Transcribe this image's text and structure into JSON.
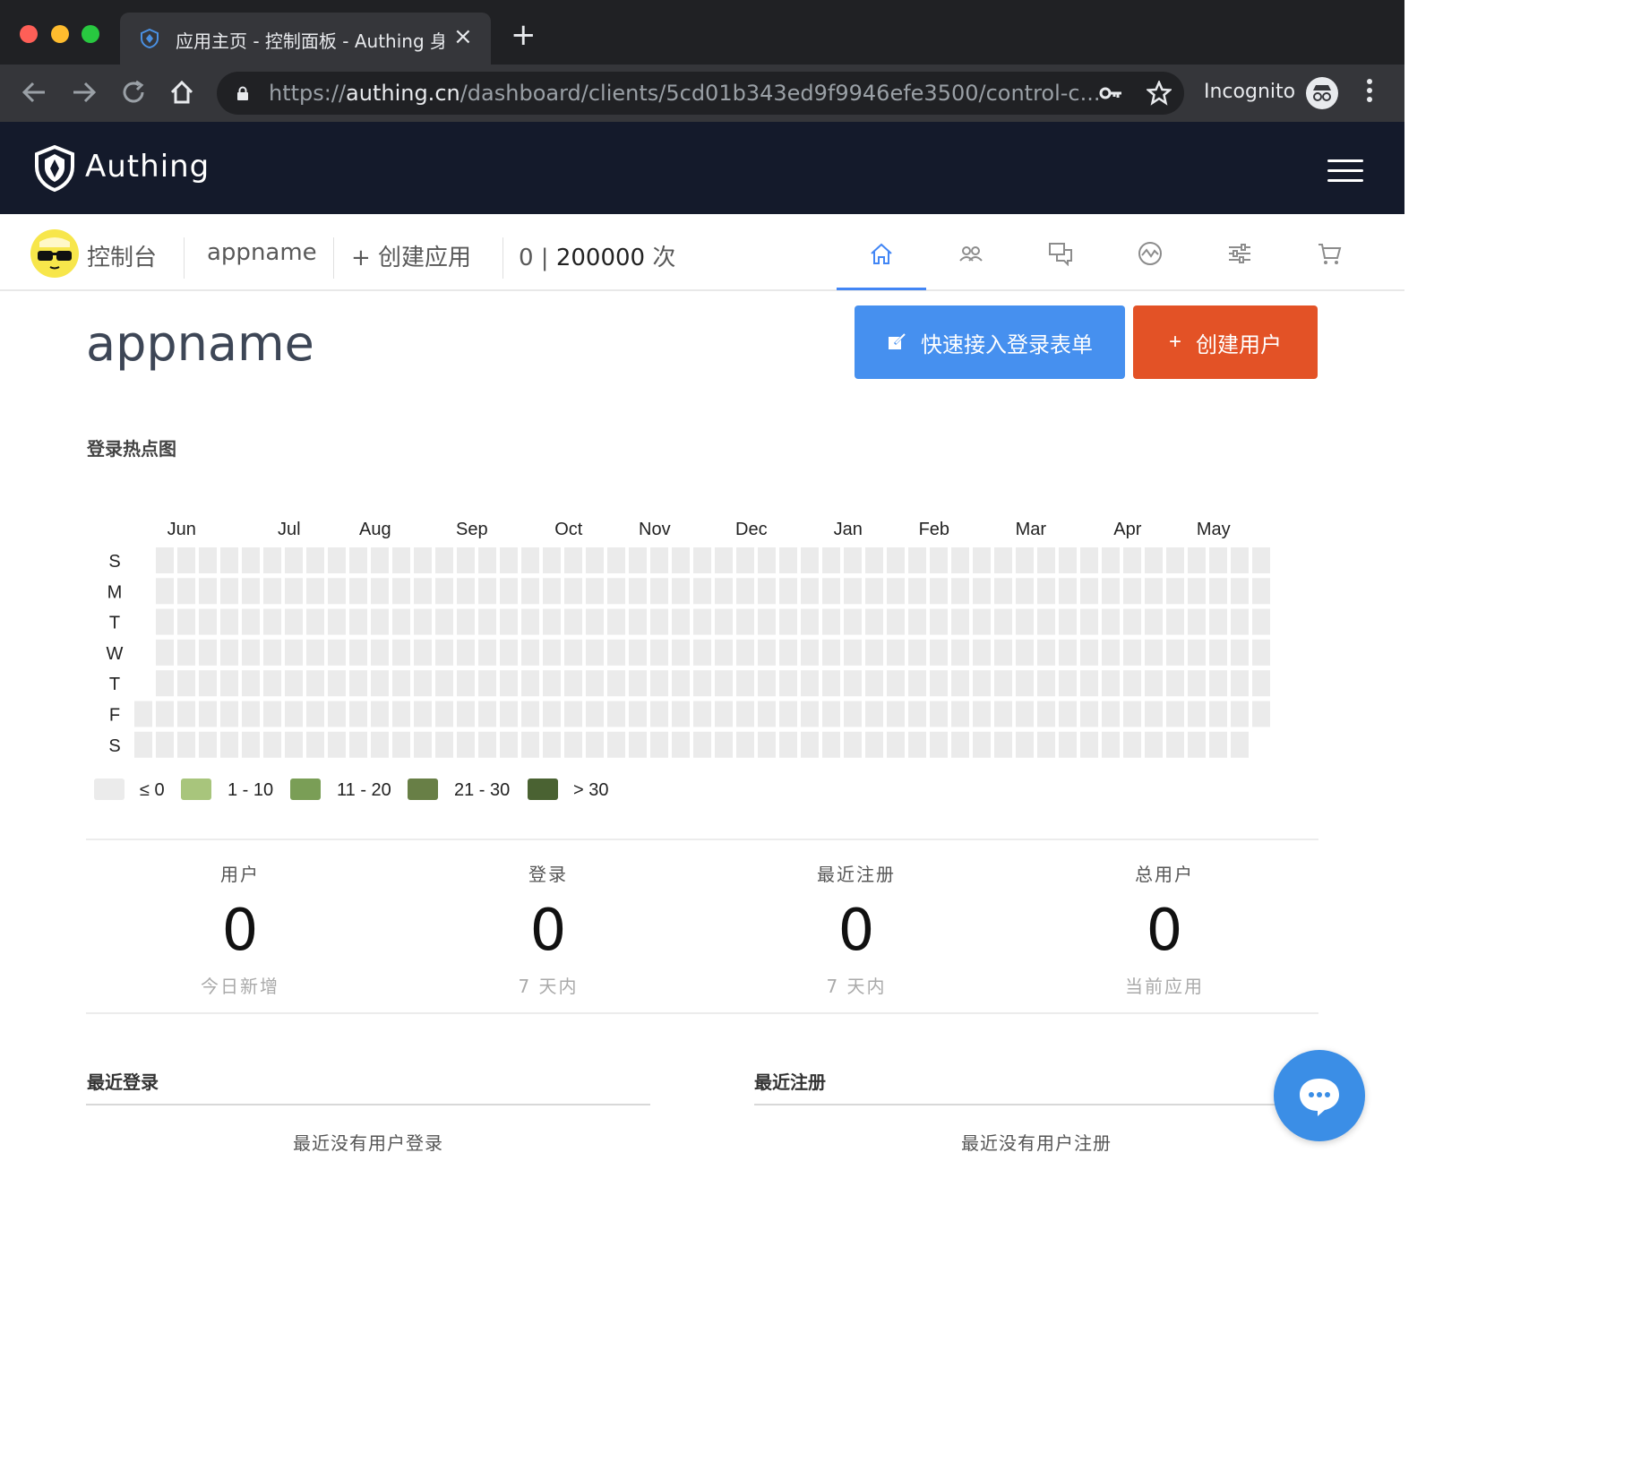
{
  "browser": {
    "tab_title": "应用主页 - 控制面板 - Authing 身",
    "url_prefix": "https://",
    "url_host": "authing.cn",
    "url_path": "/dashboard/clients/5cd01b343ed9f9946efe3500/control-c...",
    "incognito_label": "Incognito",
    "traffic_colors": [
      "#ff5f57",
      "#febc2e",
      "#28c840"
    ]
  },
  "app": {
    "brand": "Authing"
  },
  "subnav": {
    "console": "控制台",
    "app_name": "appname",
    "create_app": "+ 创建应用",
    "usage_used": "0",
    "usage_sep": " | ",
    "usage_total": "200000",
    "usage_unit": " 次",
    "tabs": [
      "home-icon",
      "users-icon",
      "messages-icon",
      "analytics-icon",
      "settings-icon",
      "cart-icon"
    ],
    "active_tab": 0,
    "accent": "#4286f5"
  },
  "main": {
    "title": "appname",
    "quick_login_button": "快速接入登录表单",
    "create_user_button": "创建用户",
    "heatmap_title": "登录热点图"
  },
  "chart_data": {
    "type": "heatmap",
    "title": "登录热点图",
    "months": [
      "Jun",
      "Jul",
      "Aug",
      "Sep",
      "Oct",
      "Nov",
      "Dec",
      "Jan",
      "Feb",
      "Mar",
      "Apr",
      "May"
    ],
    "weekdays": [
      "S",
      "M",
      "T",
      "W",
      "T",
      "F",
      "S"
    ],
    "values": "all 0",
    "legend": [
      {
        "label": "≤ 0",
        "color": "#ebebeb"
      },
      {
        "label": "1 - 10",
        "color": "#a8c57c"
      },
      {
        "label": "11 - 20",
        "color": "#7a9e56"
      },
      {
        "label": "21 - 30",
        "color": "#687f46"
      },
      {
        "label": "> 30",
        "color": "#4a6232"
      }
    ]
  },
  "stats": [
    {
      "label": "用户",
      "value": "0",
      "sub": "今日新增"
    },
    {
      "label": "登录",
      "value": "0",
      "sub": "7 天内"
    },
    {
      "label": "最近注册",
      "value": "0",
      "sub": "7 天内"
    },
    {
      "label": "总用户",
      "value": "0",
      "sub": "当前应用"
    }
  ],
  "recent": {
    "login_title": "最近登录",
    "login_empty": "最近没有用户登录",
    "register_title": "最近注册",
    "register_empty": "最近没有用户注册"
  }
}
